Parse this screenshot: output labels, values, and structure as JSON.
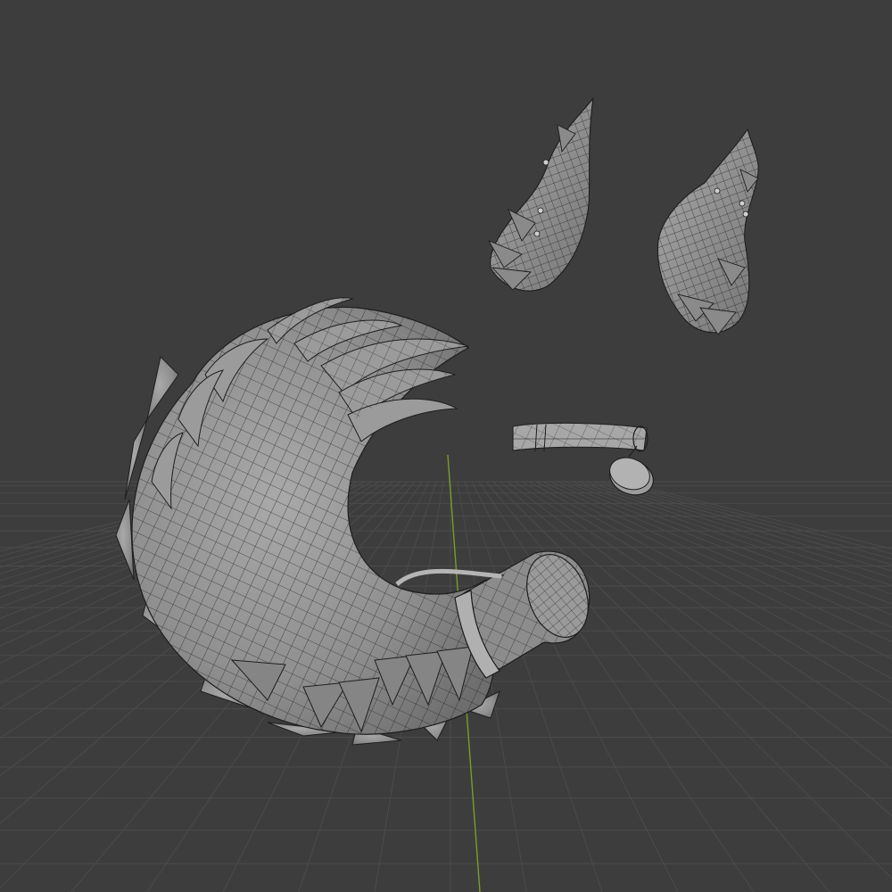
{
  "viewport": {
    "background_color": "#3d3d3d",
    "grid_color": "#4b4b4b",
    "grid_major_color": "#545454",
    "y_axis_color": "#7a9c2a",
    "mesh_fill_color": "#8f8f8f",
    "mesh_shade_color": "#6e6e6e",
    "mesh_highlight_color": "#a9a9a9",
    "wire_color": "#1e1e1e"
  },
  "objects": [
    {
      "icon": "curled-tail-mesh"
    },
    {
      "icon": "left-ear-mesh"
    },
    {
      "icon": "right-ear-mesh"
    },
    {
      "icon": "collar-mesh"
    },
    {
      "icon": "collar-tag-mesh"
    }
  ]
}
